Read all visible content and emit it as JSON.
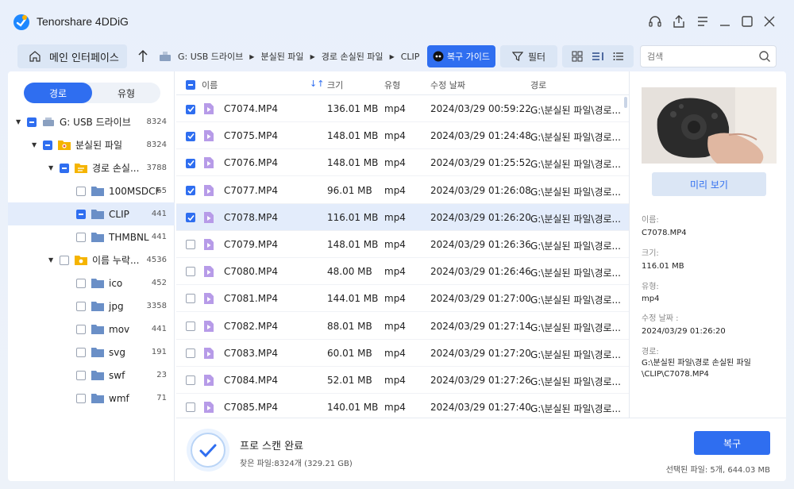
{
  "app": {
    "title": "Tenorshare 4DDiG"
  },
  "toolbar": {
    "home_label": "메인 인터페이스",
    "breadcrumbs": [
      "G: USB 드라이브",
      "분실된 파일",
      "경로 손실된 파일",
      "CLIP"
    ],
    "guide_label": "복구 가이드",
    "filter_label": "필터",
    "search_placeholder": "검색"
  },
  "tabs": {
    "path": "경로",
    "type": "유형"
  },
  "tree": [
    {
      "label": "G: USB 드라이브",
      "count": "8324"
    },
    {
      "label": "분실된 파일",
      "count": "8324"
    },
    {
      "label": "경로 손실...",
      "count": "3788"
    },
    {
      "label": "100MSDCF",
      "count": "65"
    },
    {
      "label": "CLIP",
      "count": "441"
    },
    {
      "label": "THMBNL",
      "count": "441"
    },
    {
      "label": "이름 누락...",
      "count": "4536"
    },
    {
      "label": "ico",
      "count": "452"
    },
    {
      "label": "jpg",
      "count": "3358"
    },
    {
      "label": "mov",
      "count": "441"
    },
    {
      "label": "svg",
      "count": "191"
    },
    {
      "label": "swf",
      "count": "23"
    },
    {
      "label": "wmf",
      "count": "71"
    }
  ],
  "columns": {
    "name": "이름",
    "size": "크기",
    "type": "유형",
    "modified": "수정 날짜",
    "path": "경로"
  },
  "files": [
    {
      "name": "C7074.MP4",
      "size": "136.01 MB",
      "type": "mp4",
      "date": "2024/03/29 00:59:22",
      "path": "G:\\분실된 파일\\경로..."
    },
    {
      "name": "C7075.MP4",
      "size": "148.01 MB",
      "type": "mp4",
      "date": "2024/03/29 01:24:48",
      "path": "G:\\분실된 파일\\경로..."
    },
    {
      "name": "C7076.MP4",
      "size": "148.01 MB",
      "type": "mp4",
      "date": "2024/03/29 01:25:52",
      "path": "G:\\분실된 파일\\경로..."
    },
    {
      "name": "C7077.MP4",
      "size": "96.01 MB",
      "type": "mp4",
      "date": "2024/03/29 01:26:08",
      "path": "G:\\분실된 파일\\경로..."
    },
    {
      "name": "C7078.MP4",
      "size": "116.01 MB",
      "type": "mp4",
      "date": "2024/03/29 01:26:20",
      "path": "G:\\분실된 파일\\경로..."
    },
    {
      "name": "C7079.MP4",
      "size": "148.01 MB",
      "type": "mp4",
      "date": "2024/03/29 01:26:36",
      "path": "G:\\분실된 파일\\경로..."
    },
    {
      "name": "C7080.MP4",
      "size": "48.00 MB",
      "type": "mp4",
      "date": "2024/03/29 01:26:46",
      "path": "G:\\분실된 파일\\경로..."
    },
    {
      "name": "C7081.MP4",
      "size": "144.01 MB",
      "type": "mp4",
      "date": "2024/03/29 01:27:00",
      "path": "G:\\분실된 파일\\경로..."
    },
    {
      "name": "C7082.MP4",
      "size": "88.01 MB",
      "type": "mp4",
      "date": "2024/03/29 01:27:14",
      "path": "G:\\분실된 파일\\경로..."
    },
    {
      "name": "C7083.MP4",
      "size": "60.01 MB",
      "type": "mp4",
      "date": "2024/03/29 01:27:20",
      "path": "G:\\분실된 파일\\경로..."
    },
    {
      "name": "C7084.MP4",
      "size": "52.01 MB",
      "type": "mp4",
      "date": "2024/03/29 01:27:26",
      "path": "G:\\분실된 파일\\경로..."
    },
    {
      "name": "C7085.MP4",
      "size": "140.01 MB",
      "type": "mp4",
      "date": "2024/03/29 01:27:40",
      "path": "G:\\분실된 파일\\경로..."
    }
  ],
  "preview": {
    "button_label": "미리 보기",
    "name_label": "이름:",
    "name_value": "C7078.MP4",
    "size_label": "크기:",
    "size_value": "116.01 MB",
    "type_label": "유형:",
    "type_value": "mp4",
    "date_label": "수정 날짜 :",
    "date_value": "2024/03/29 01:26:20",
    "path_label": "경로:",
    "path_value": "G:\\분실된 파일\\경로 손실된 파일\\CLIP\\C7078.MP4"
  },
  "status": {
    "title": "프로 스캔 완료",
    "found": "찾은 파일:8324개 (329.21 GB)",
    "recover_label": "복구",
    "selected": "선택된 파일: 5개, 644.03 MB"
  },
  "colors": {
    "accent": "#2f6ef0",
    "folder": "#f5b400",
    "file_icon": "#b79be8"
  }
}
